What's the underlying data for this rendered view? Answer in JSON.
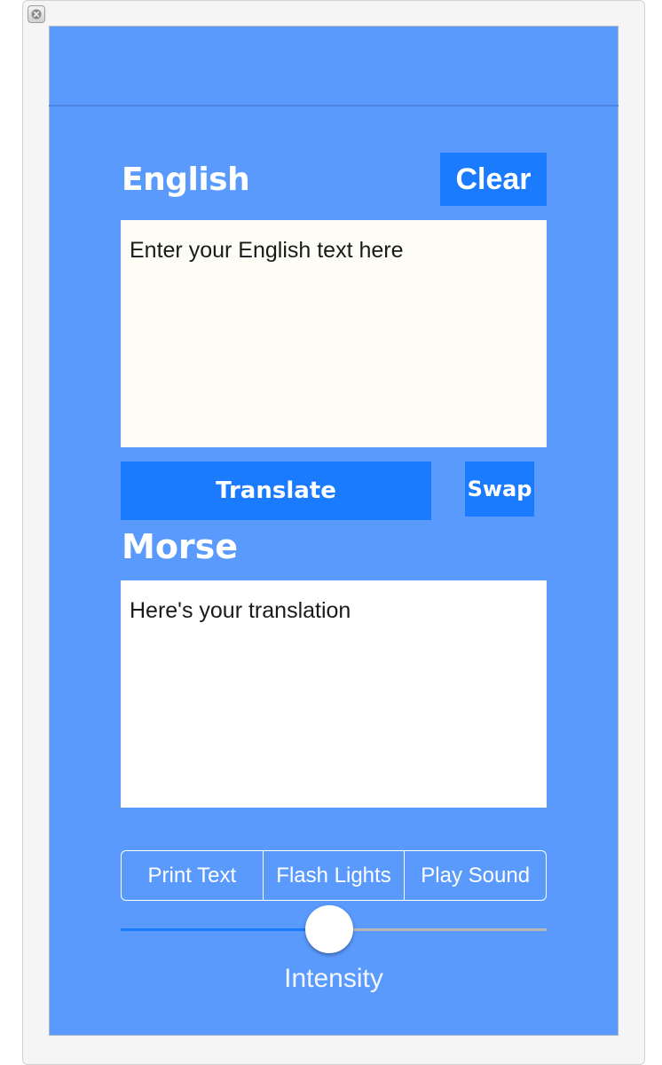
{
  "window": {
    "close_icon": "close-box-icon"
  },
  "english": {
    "label": "English",
    "clear_label": "Clear",
    "placeholder": "Enter your English text here"
  },
  "actions": {
    "translate_label": "Translate",
    "swap_label": "Swap"
  },
  "morse": {
    "label": "Morse",
    "placeholder": "Here's your translation"
  },
  "output_modes": {
    "options": [
      "Print Text",
      "Flash Lights",
      "Play Sound"
    ]
  },
  "intensity": {
    "label": "Intensity",
    "value": 0.49
  },
  "colors": {
    "background": "#5a9afd",
    "button": "#1a7bff",
    "english_field": "#fdfdf6",
    "morse_field": "#ffffff"
  }
}
